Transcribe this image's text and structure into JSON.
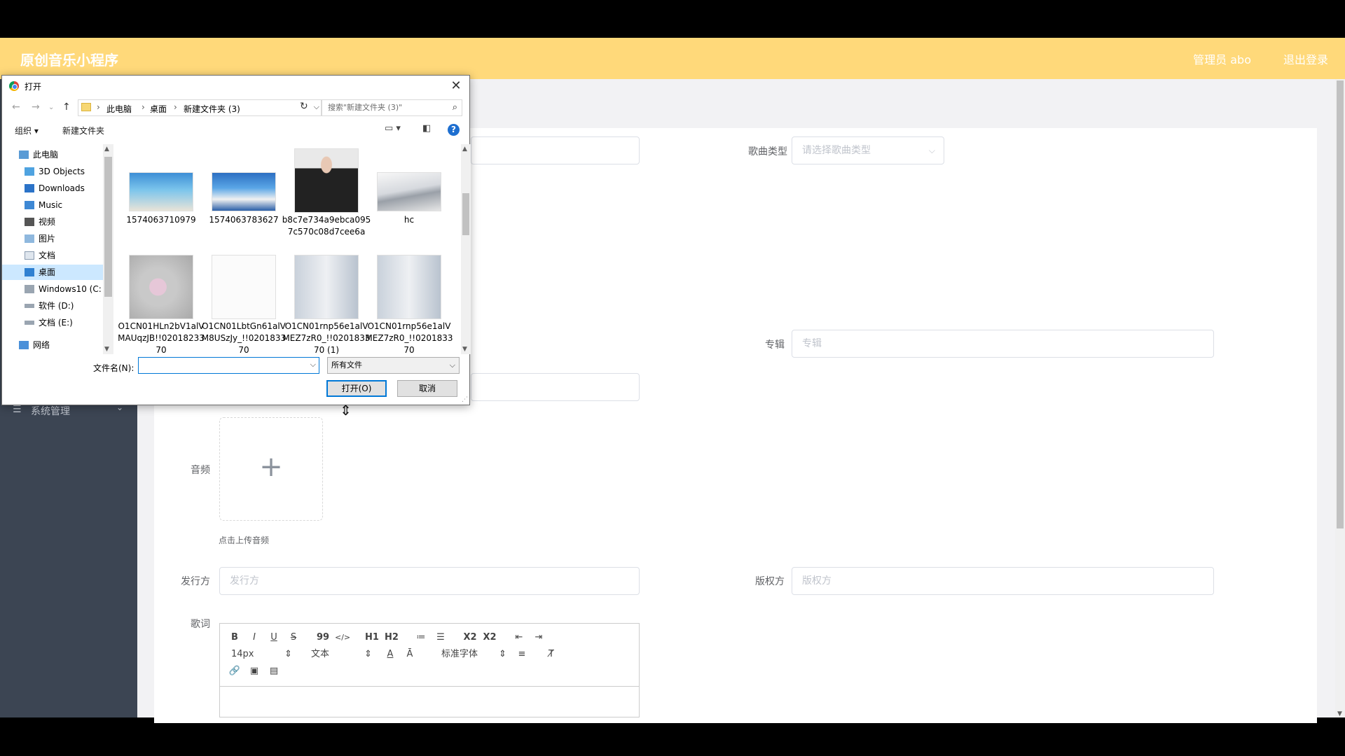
{
  "app": {
    "brand": "原创音乐小程序",
    "admin_label": "管理员 abo",
    "logout": "退出登录",
    "colors": {
      "header_bg": "#ffd97a",
      "sidebar_bg": "#3c4553",
      "accent": "#0078d7"
    }
  },
  "sidebar": {
    "items": [
      {
        "label": "系统管理",
        "icon": "menu-lines-icon"
      }
    ]
  },
  "form": {
    "song_type_label": "歌曲类型",
    "song_type_placeholder": "请选择歌曲类型",
    "album_label": "专辑",
    "album_placeholder": "专辑",
    "audio_label": "音频",
    "upload_tip": "点击上传音频",
    "publisher_label": "发行方",
    "publisher_placeholder": "发行方",
    "copyright_label": "版权方",
    "copyright_placeholder": "版权方",
    "lyrics_label": "歌词"
  },
  "editor": {
    "font_size": "14px",
    "text_style": "文本",
    "font_family": "标准字体",
    "bold": "B",
    "italic": "I",
    "underline": "U",
    "strike": "S",
    "quote": "99",
    "code": "</>",
    "h1": "H1",
    "h2": "H2",
    "sub": "X2",
    "sup": "X2"
  },
  "dialog": {
    "title": "打开",
    "breadcrumbs": [
      "此电脑",
      "桌面",
      "新建文件夹 (3)"
    ],
    "search_placeholder": "搜索\"新建文件夹 (3)\"",
    "organize": "组织 ▾",
    "new_folder": "新建文件夹",
    "tree": [
      {
        "label": "此电脑",
        "icon": "computer-icon"
      },
      {
        "label": "3D Objects",
        "icon": "cube-icon"
      },
      {
        "label": "Downloads",
        "icon": "download-icon"
      },
      {
        "label": "Music",
        "icon": "music-icon"
      },
      {
        "label": "视频",
        "icon": "video-icon"
      },
      {
        "label": "图片",
        "icon": "picture-icon"
      },
      {
        "label": "文档",
        "icon": "document-icon"
      },
      {
        "label": "桌面",
        "icon": "desktop-icon",
        "selected": true
      },
      {
        "label": "Windows10 (C:",
        "icon": "drive-icon"
      },
      {
        "label": "软件 (D:)",
        "icon": "drive-icon"
      },
      {
        "label": "文档 (E:)",
        "icon": "drive-icon"
      },
      {
        "label": "网络",
        "icon": "network-icon"
      }
    ],
    "files": [
      {
        "name": "1574063710979"
      },
      {
        "name": "1574063783627"
      },
      {
        "name": "b8c7e734a9ebca0957c570c08d7cee6a"
      },
      {
        "name": "hc"
      },
      {
        "name": "O1CN01HLn2bV1alVMAUqzJB!!0201823370"
      },
      {
        "name": "O1CN01LbtGn61alVM8USzJy_!!020183370"
      },
      {
        "name": "O1CN01rnp56e1alVMEZ7zR0_!!020183370 (1)"
      },
      {
        "name": "O1CN01rnp56e1alVMEZ7zR0_!!020183370"
      }
    ],
    "filename_label": "文件名(N):",
    "filename_value": "",
    "filter": "所有文件",
    "open_button": "打开(O)",
    "cancel_button": "取消"
  }
}
